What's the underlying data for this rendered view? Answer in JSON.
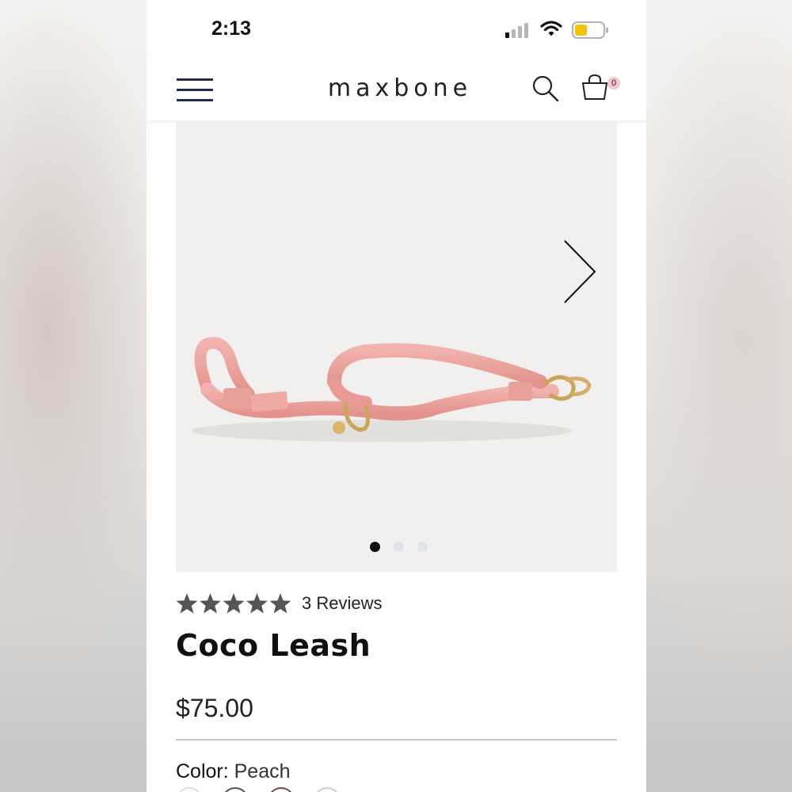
{
  "status_bar": {
    "time": "2:13",
    "battery_color": "#f5c400"
  },
  "header": {
    "brand": "maxbone",
    "cart_count": "0",
    "icons": [
      "menu-icon",
      "search-icon",
      "cart-icon"
    ]
  },
  "gallery": {
    "image": "pink-leash-product-image",
    "dots_total": 3,
    "active_dot": 1,
    "next_icon": "chevron-right-icon"
  },
  "product": {
    "rating": 5,
    "reviews_label": "3 Reviews",
    "title": "Coco Leash",
    "price": "$75.00",
    "color_label": "Color:",
    "color_value": " Peach"
  },
  "colors": {
    "leash": "#f0a8a4",
    "hardware": "#c9a55a"
  }
}
